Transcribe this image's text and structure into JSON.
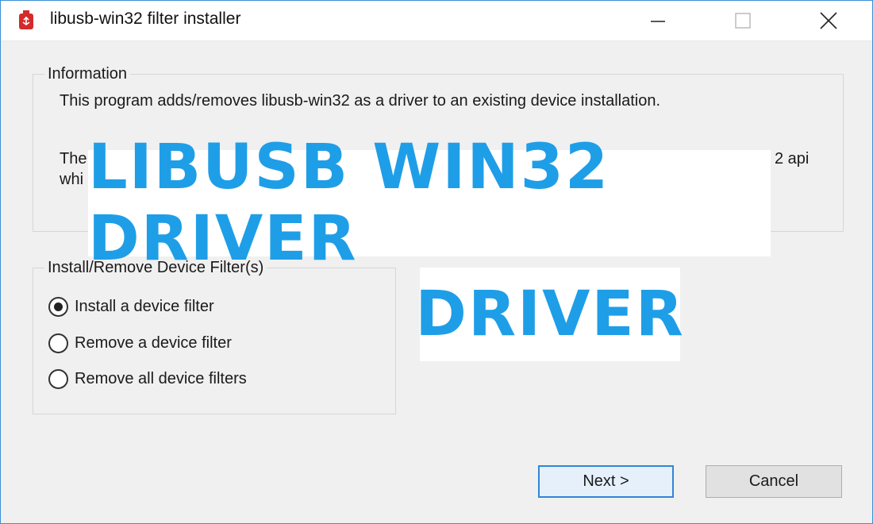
{
  "window": {
    "title": "libusb-win32 filter installer",
    "icon": "usb-app-icon",
    "controls": [
      "minimize-icon",
      "maximize-icon",
      "close-icon"
    ]
  },
  "information": {
    "legend": "Information",
    "paragraph1": "This program adds/removes libusb-win32 as a driver to an existing device installation.",
    "paragraph2_line1_start": "The",
    "paragraph2_line1_end": "2 api",
    "paragraph2_line2_start": "whi"
  },
  "filter_group": {
    "legend": "Install/Remove Device Filter(s)",
    "options": [
      {
        "label": "Install a device filter",
        "selected": true
      },
      {
        "label": "Remove a device filter",
        "selected": false
      },
      {
        "label": "Remove all device filters",
        "selected": false
      }
    ]
  },
  "buttons": {
    "next": "Next >",
    "cancel": "Cancel"
  },
  "overlay": {
    "banner_main": "LIBUSB WIN32 DRIVER",
    "banner_sub": "DRIVER",
    "color": "#1f9ee8"
  }
}
